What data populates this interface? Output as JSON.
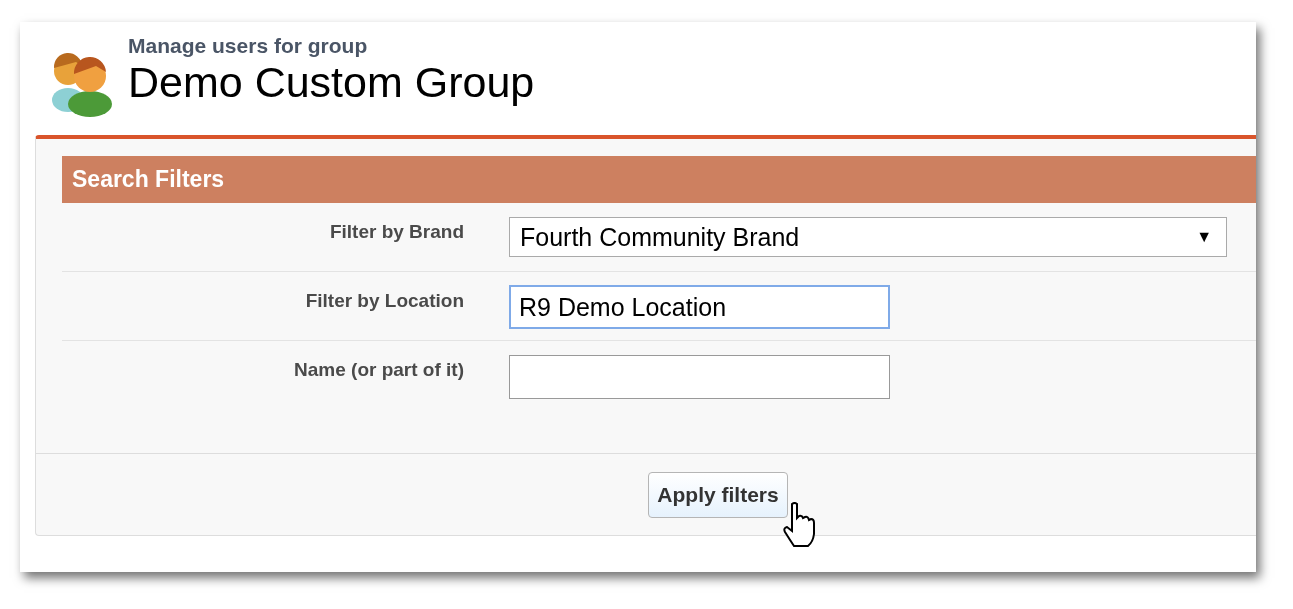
{
  "header": {
    "subtitle": "Manage users for group",
    "title": "Demo Custom Group"
  },
  "section": {
    "title": "Search Filters"
  },
  "fields": [
    {
      "kind": "select",
      "label": "Filter by Brand",
      "value": "Fourth Community Brand",
      "arrow": "▼"
    },
    {
      "kind": "text",
      "label": "Filter by Location",
      "value": "R9 Demo Location",
      "focused": true
    },
    {
      "kind": "text",
      "label": "Name (or part of it)",
      "focused": false
    }
  ],
  "button": {
    "label": "Apply filters"
  }
}
